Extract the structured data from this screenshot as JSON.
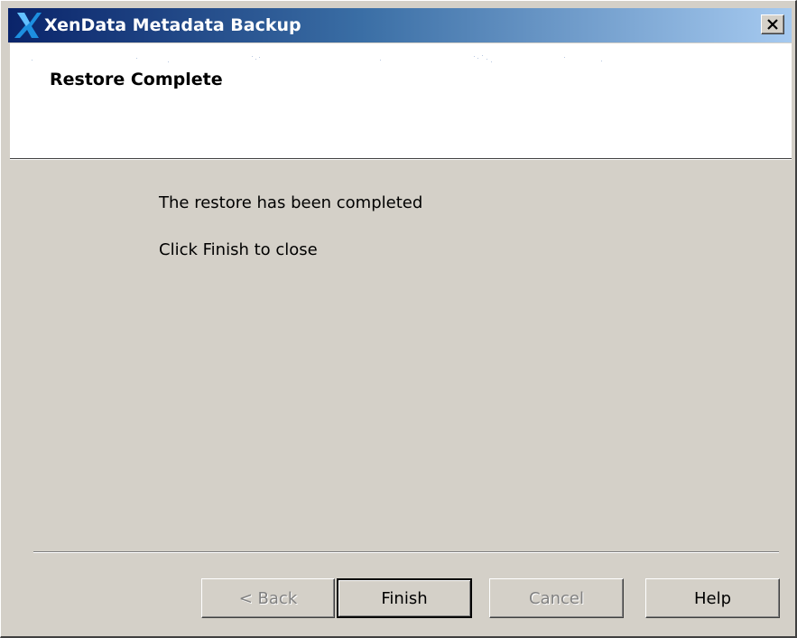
{
  "window": {
    "title": "XenData Metadata Backup",
    "logo_icon": "xendata-x-logo-icon",
    "close_icon": "close-x-icon"
  },
  "header": {
    "title": "Restore Complete"
  },
  "body": {
    "message": "The restore has been completed",
    "instruction": "Click Finish to close"
  },
  "buttons": {
    "back": "< Back",
    "finish": "Finish",
    "cancel": "Cancel",
    "help": "Help"
  },
  "state": {
    "back_enabled": false,
    "finish_enabled": true,
    "finish_is_default": true,
    "cancel_enabled": false,
    "help_enabled": true
  },
  "colors": {
    "title_gradient_start": "#0a246a",
    "title_gradient_end": "#a6caf0",
    "dialog_background": "#d4d0c8",
    "header_background": "#ffffff"
  }
}
